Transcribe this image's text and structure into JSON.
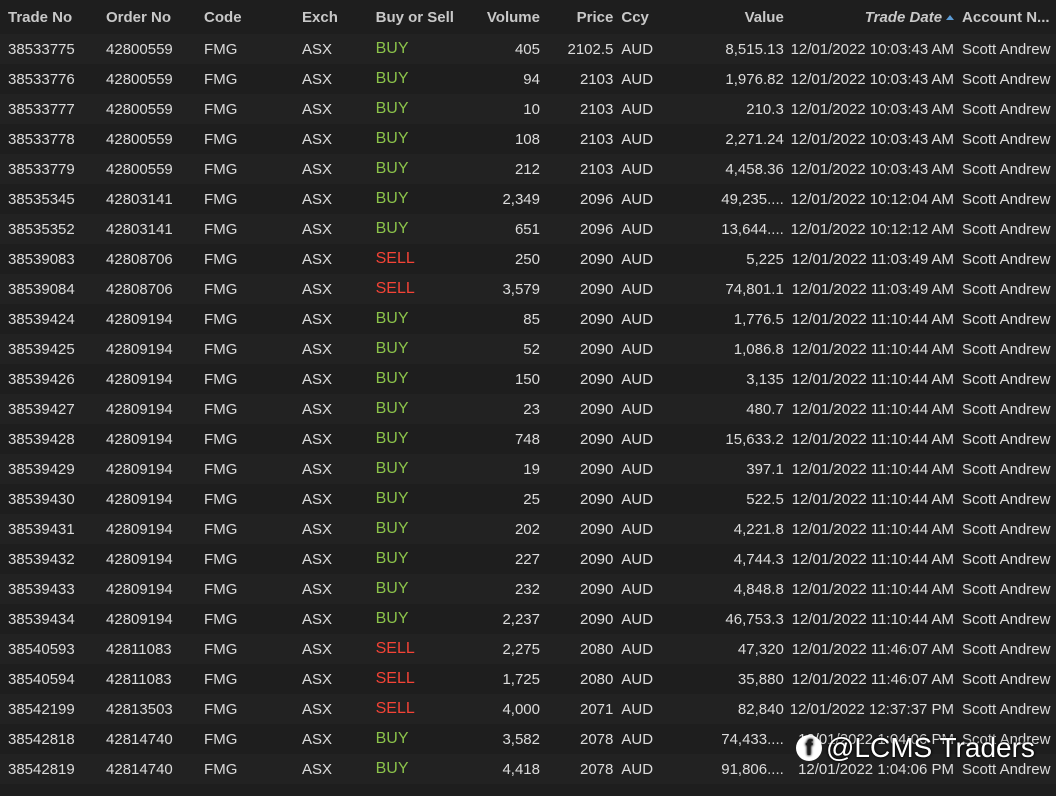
{
  "columns": {
    "trade_no": "Trade No",
    "order_no": "Order No",
    "code": "Code",
    "exch": "Exch",
    "side": "Buy or Sell",
    "volume": "Volume",
    "price": "Price",
    "ccy": "Ccy",
    "value": "Value",
    "trade_date": "Trade Date",
    "account": "Account N..."
  },
  "rows": [
    [
      "38533775",
      "42800559",
      "FMG",
      "ASX",
      "BUY",
      "405",
      "2102.5",
      "AUD",
      "8,515.13",
      "12/01/2022 10:03:43 AM",
      "Scott Andrew"
    ],
    [
      "38533776",
      "42800559",
      "FMG",
      "ASX",
      "BUY",
      "94",
      "2103",
      "AUD",
      "1,976.82",
      "12/01/2022 10:03:43 AM",
      "Scott Andrew"
    ],
    [
      "38533777",
      "42800559",
      "FMG",
      "ASX",
      "BUY",
      "10",
      "2103",
      "AUD",
      "210.3",
      "12/01/2022 10:03:43 AM",
      "Scott Andrew"
    ],
    [
      "38533778",
      "42800559",
      "FMG",
      "ASX",
      "BUY",
      "108",
      "2103",
      "AUD",
      "2,271.24",
      "12/01/2022 10:03:43 AM",
      "Scott Andrew"
    ],
    [
      "38533779",
      "42800559",
      "FMG",
      "ASX",
      "BUY",
      "212",
      "2103",
      "AUD",
      "4,458.36",
      "12/01/2022 10:03:43 AM",
      "Scott Andrew"
    ],
    [
      "38535345",
      "42803141",
      "FMG",
      "ASX",
      "BUY",
      "2,349",
      "2096",
      "AUD",
      "49,235....",
      "12/01/2022 10:12:04 AM",
      "Scott Andrew"
    ],
    [
      "38535352",
      "42803141",
      "FMG",
      "ASX",
      "BUY",
      "651",
      "2096",
      "AUD",
      "13,644....",
      "12/01/2022 10:12:12 AM",
      "Scott Andrew"
    ],
    [
      "38539083",
      "42808706",
      "FMG",
      "ASX",
      "SELL",
      "250",
      "2090",
      "AUD",
      "5,225",
      "12/01/2022 11:03:49 AM",
      "Scott Andrew"
    ],
    [
      "38539084",
      "42808706",
      "FMG",
      "ASX",
      "SELL",
      "3,579",
      "2090",
      "AUD",
      "74,801.1",
      "12/01/2022 11:03:49 AM",
      "Scott Andrew"
    ],
    [
      "38539424",
      "42809194",
      "FMG",
      "ASX",
      "BUY",
      "85",
      "2090",
      "AUD",
      "1,776.5",
      "12/01/2022 11:10:44 AM",
      "Scott Andrew"
    ],
    [
      "38539425",
      "42809194",
      "FMG",
      "ASX",
      "BUY",
      "52",
      "2090",
      "AUD",
      "1,086.8",
      "12/01/2022 11:10:44 AM",
      "Scott Andrew"
    ],
    [
      "38539426",
      "42809194",
      "FMG",
      "ASX",
      "BUY",
      "150",
      "2090",
      "AUD",
      "3,135",
      "12/01/2022 11:10:44 AM",
      "Scott Andrew"
    ],
    [
      "38539427",
      "42809194",
      "FMG",
      "ASX",
      "BUY",
      "23",
      "2090",
      "AUD",
      "480.7",
      "12/01/2022 11:10:44 AM",
      "Scott Andrew"
    ],
    [
      "38539428",
      "42809194",
      "FMG",
      "ASX",
      "BUY",
      "748",
      "2090",
      "AUD",
      "15,633.2",
      "12/01/2022 11:10:44 AM",
      "Scott Andrew"
    ],
    [
      "38539429",
      "42809194",
      "FMG",
      "ASX",
      "BUY",
      "19",
      "2090",
      "AUD",
      "397.1",
      "12/01/2022 11:10:44 AM",
      "Scott Andrew"
    ],
    [
      "38539430",
      "42809194",
      "FMG",
      "ASX",
      "BUY",
      "25",
      "2090",
      "AUD",
      "522.5",
      "12/01/2022 11:10:44 AM",
      "Scott Andrew"
    ],
    [
      "38539431",
      "42809194",
      "FMG",
      "ASX",
      "BUY",
      "202",
      "2090",
      "AUD",
      "4,221.8",
      "12/01/2022 11:10:44 AM",
      "Scott Andrew"
    ],
    [
      "38539432",
      "42809194",
      "FMG",
      "ASX",
      "BUY",
      "227",
      "2090",
      "AUD",
      "4,744.3",
      "12/01/2022 11:10:44 AM",
      "Scott Andrew"
    ],
    [
      "38539433",
      "42809194",
      "FMG",
      "ASX",
      "BUY",
      "232",
      "2090",
      "AUD",
      "4,848.8",
      "12/01/2022 11:10:44 AM",
      "Scott Andrew"
    ],
    [
      "38539434",
      "42809194",
      "FMG",
      "ASX",
      "BUY",
      "2,237",
      "2090",
      "AUD",
      "46,753.3",
      "12/01/2022 11:10:44 AM",
      "Scott Andrew"
    ],
    [
      "38540593",
      "42811083",
      "FMG",
      "ASX",
      "SELL",
      "2,275",
      "2080",
      "AUD",
      "47,320",
      "12/01/2022 11:46:07 AM",
      "Scott Andrew"
    ],
    [
      "38540594",
      "42811083",
      "FMG",
      "ASX",
      "SELL",
      "1,725",
      "2080",
      "AUD",
      "35,880",
      "12/01/2022 11:46:07 AM",
      "Scott Andrew"
    ],
    [
      "38542199",
      "42813503",
      "FMG",
      "ASX",
      "SELL",
      "4,000",
      "2071",
      "AUD",
      "82,840",
      "12/01/2022 12:37:37 PM",
      "Scott Andrew"
    ],
    [
      "38542818",
      "42814740",
      "FMG",
      "ASX",
      "BUY",
      "3,582",
      "2078",
      "AUD",
      "74,433....",
      "12/01/2022 1:04:06 PM",
      "Scott Andrew"
    ],
    [
      "38542819",
      "42814740",
      "FMG",
      "ASX",
      "BUY",
      "4,418",
      "2078",
      "AUD",
      "91,806....",
      "12/01/2022 1:04:06 PM",
      "Scott Andrew"
    ]
  ],
  "colors": {
    "buy": "#8bc34a",
    "sell": "#f44336",
    "background": "#1e1e1e",
    "sort_indicator": "#5b9bd5"
  },
  "sort": {
    "column": "trade_date",
    "direction": "ascending"
  },
  "icons": {
    "sort": "sort-ascending-icon",
    "watermark": "facebook-icon"
  },
  "watermark": {
    "text": "@LCMS Traders",
    "icon_glyph": "f"
  }
}
